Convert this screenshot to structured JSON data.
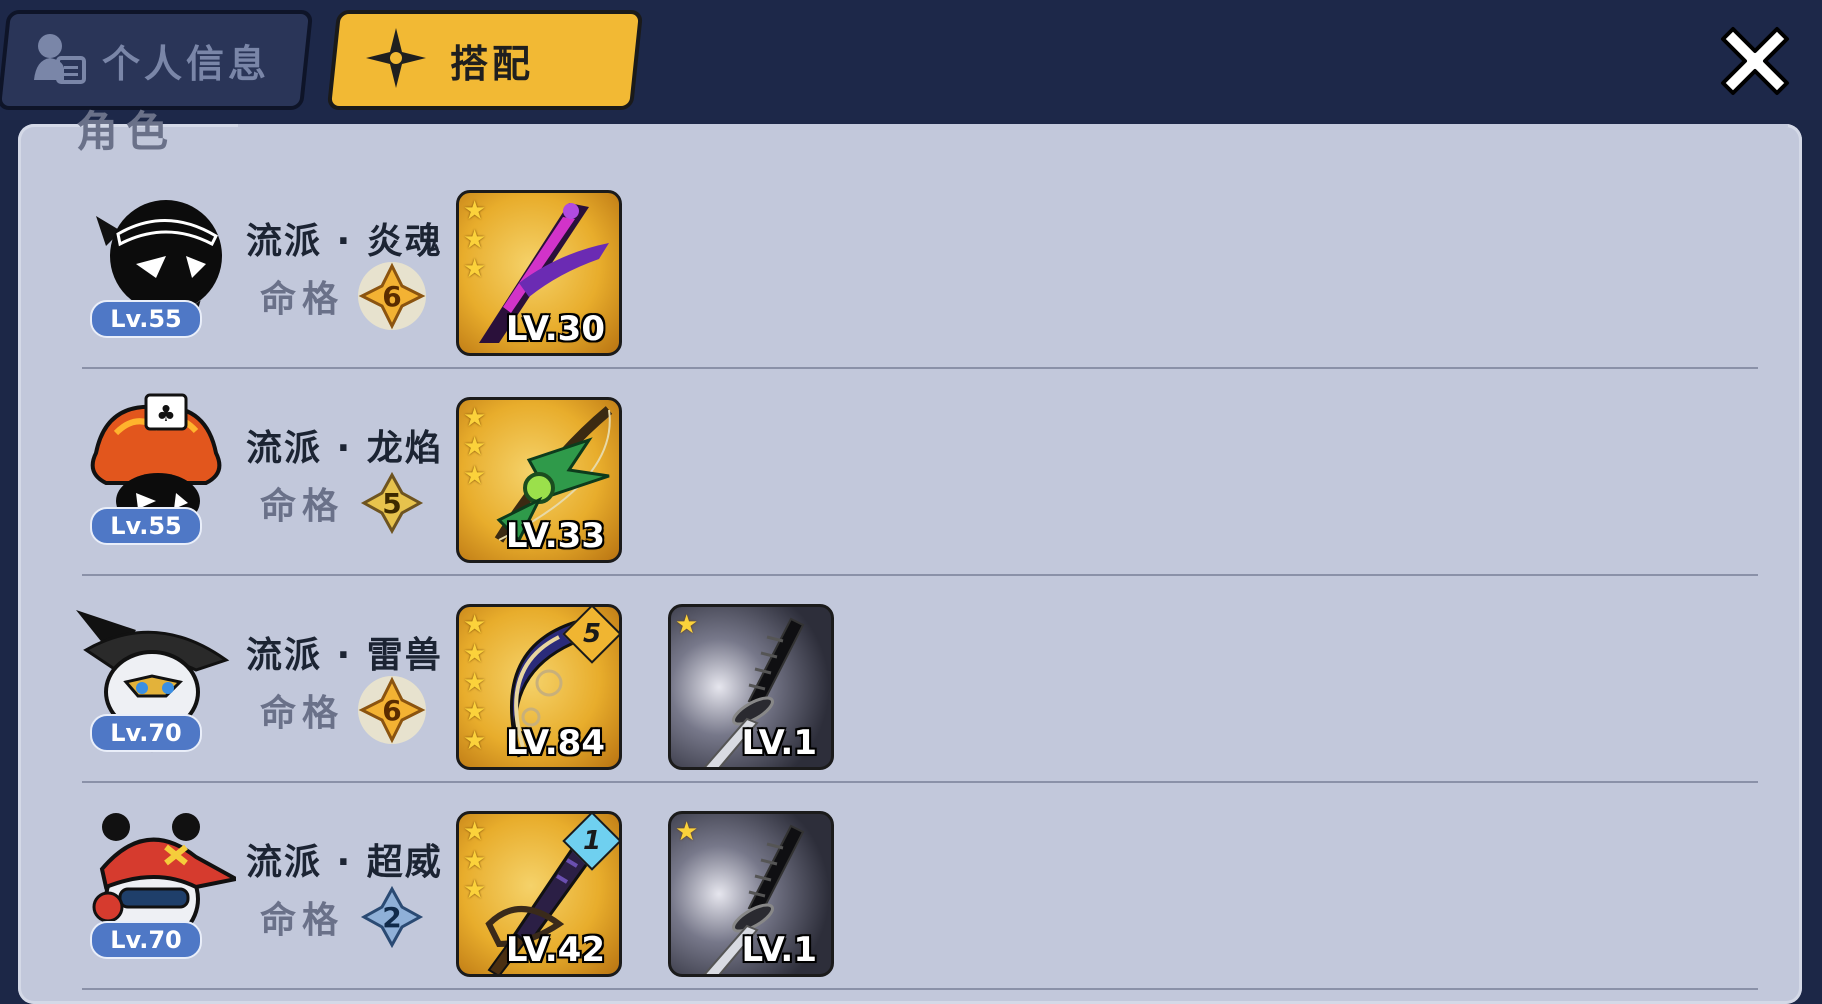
{
  "tabs": [
    {
      "label": "个人信息",
      "icon": "profile-card-icon",
      "active": false
    },
    {
      "label": "搭配",
      "icon": "shuriken-icon",
      "active": true
    }
  ],
  "close_icon": "close-icon",
  "section": {
    "title": "角色"
  },
  "colors": {
    "active_tab": "#f2b934",
    "panel": "#c2c8db",
    "header": "#1d2849",
    "level_badge": "#4f78c6"
  },
  "characters": [
    {
      "avatar": "black-ninja-avatar",
      "level": "Lv.55",
      "school": "流派 · 炎魂",
      "fate_label": "命格",
      "fate_value": "6",
      "weapons": [
        {
          "icon": "purple-blade-icon",
          "stars": 3,
          "level": "LV.30",
          "rank": null,
          "frame": "gold"
        }
      ]
    },
    {
      "avatar": "fire-hat-ninja-avatar",
      "level": "Lv.55",
      "school": "流派 · 龙焰",
      "fate_label": "命格",
      "fate_value": "5",
      "weapons": [
        {
          "icon": "green-dragon-bow-icon",
          "stars": 3,
          "level": "LV.33",
          "rank": null,
          "frame": "gold"
        }
      ]
    },
    {
      "avatar": "armored-panda-ninja-avatar",
      "level": "Lv.70",
      "school": "流派 · 雷兽",
      "fate_label": "命格",
      "fate_value": "6",
      "weapons": [
        {
          "icon": "moon-bow-icon",
          "stars": 5,
          "level": "LV.84",
          "rank": "5",
          "frame": "gold"
        },
        {
          "icon": "katana-icon",
          "stars": 1,
          "level": "LV.1",
          "rank": null,
          "frame": "dark"
        }
      ]
    },
    {
      "avatar": "red-cap-panda-avatar",
      "level": "Lv.70",
      "school": "流派 · 超威",
      "fate_label": "命格",
      "fate_value": "2",
      "weapons": [
        {
          "icon": "dark-sword-icon",
          "stars": 3,
          "level": "LV.42",
          "rank": "1",
          "frame": "gold"
        },
        {
          "icon": "katana-icon",
          "stars": 1,
          "level": "LV.1",
          "rank": null,
          "frame": "dark"
        }
      ]
    }
  ]
}
